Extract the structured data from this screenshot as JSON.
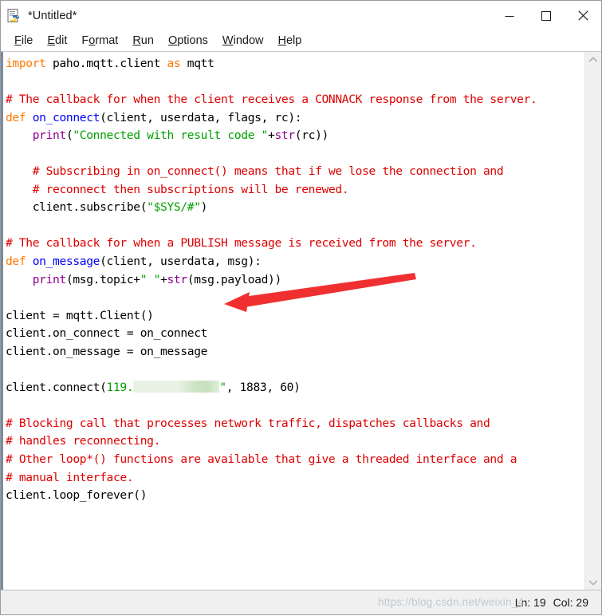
{
  "window": {
    "title": "*Untitled*",
    "icon": "python-idle-icon",
    "controls": [
      {
        "name": "minimize",
        "glyph": "minimize-icon"
      },
      {
        "name": "maximize",
        "glyph": "maximize-icon"
      },
      {
        "name": "close",
        "glyph": "close-icon"
      }
    ]
  },
  "menubar": {
    "items": [
      {
        "label": "File",
        "mnemonic": "F",
        "rest": "ile"
      },
      {
        "label": "Edit",
        "mnemonic": "E",
        "rest": "dit"
      },
      {
        "label": "Format",
        "mnemonic": "F",
        "pre": "F",
        "rest": "ormat"
      },
      {
        "label": "Run",
        "mnemonic": "R",
        "rest": "un"
      },
      {
        "label": "Options",
        "mnemonic": "O",
        "rest": "ptions"
      },
      {
        "label": "Window",
        "mnemonic": "W",
        "rest": "indow"
      },
      {
        "label": "Help",
        "mnemonic": "H",
        "rest": "elp"
      }
    ]
  },
  "editor": {
    "language": "python",
    "lines": [
      "import paho.mqtt.client as mqtt",
      "",
      "# The callback for when the client receives a CONNACK response from the server.",
      "def on_connect(client, userdata, flags, rc):",
      "    print(\"Connected with result code \"+str(rc))",
      "",
      "    # Subscribing in on_connect() means that if we lose the connection and",
      "    # reconnect then subscriptions will be renewed.",
      "    client.subscribe(\"$SYS/#\")",
      "",
      "# The callback for when a PUBLISH message is received from the server.",
      "def on_message(client, userdata, msg):",
      "    print(msg.topic+\" \"+str(msg.payload))",
      "",
      "client = mqtt.Client()",
      "client.on_connect = on_connect",
      "client.on_message = on_message",
      "",
      "client.connect(\"119.[REDACTED]\", 1883, 60)",
      "",
      "# Blocking call that processes network traffic, dispatches callbacks and",
      "# handles reconnecting.",
      "# Other loop*() functions are available that give a threaded interface and a",
      "# manual interface.",
      "client.loop_forever()"
    ],
    "redacted_host_prefix": "119.",
    "connect_port": "1883",
    "connect_keepalive": "60",
    "colors": {
      "keyword": "#ff7700",
      "definition": "#0000ff",
      "string": "#00a000",
      "comment": "#dd0000",
      "builtin": "#900090",
      "text": "#000000",
      "background": "#ffffff"
    }
  },
  "annotation": {
    "type": "arrow",
    "color": "#f03030",
    "points_to": "redacted-ip-address"
  },
  "scrollbar": {
    "up_arrow": "chevron-up-icon",
    "down_arrow": "chevron-down-icon"
  },
  "statusbar": {
    "line_label": "Ln:",
    "line_value": "19",
    "col_label": "Col:",
    "col_value": "29",
    "text": "Ln: 19  Col: 29"
  },
  "watermark": {
    "text": "https://blog.csdn.net/weixin_4"
  }
}
